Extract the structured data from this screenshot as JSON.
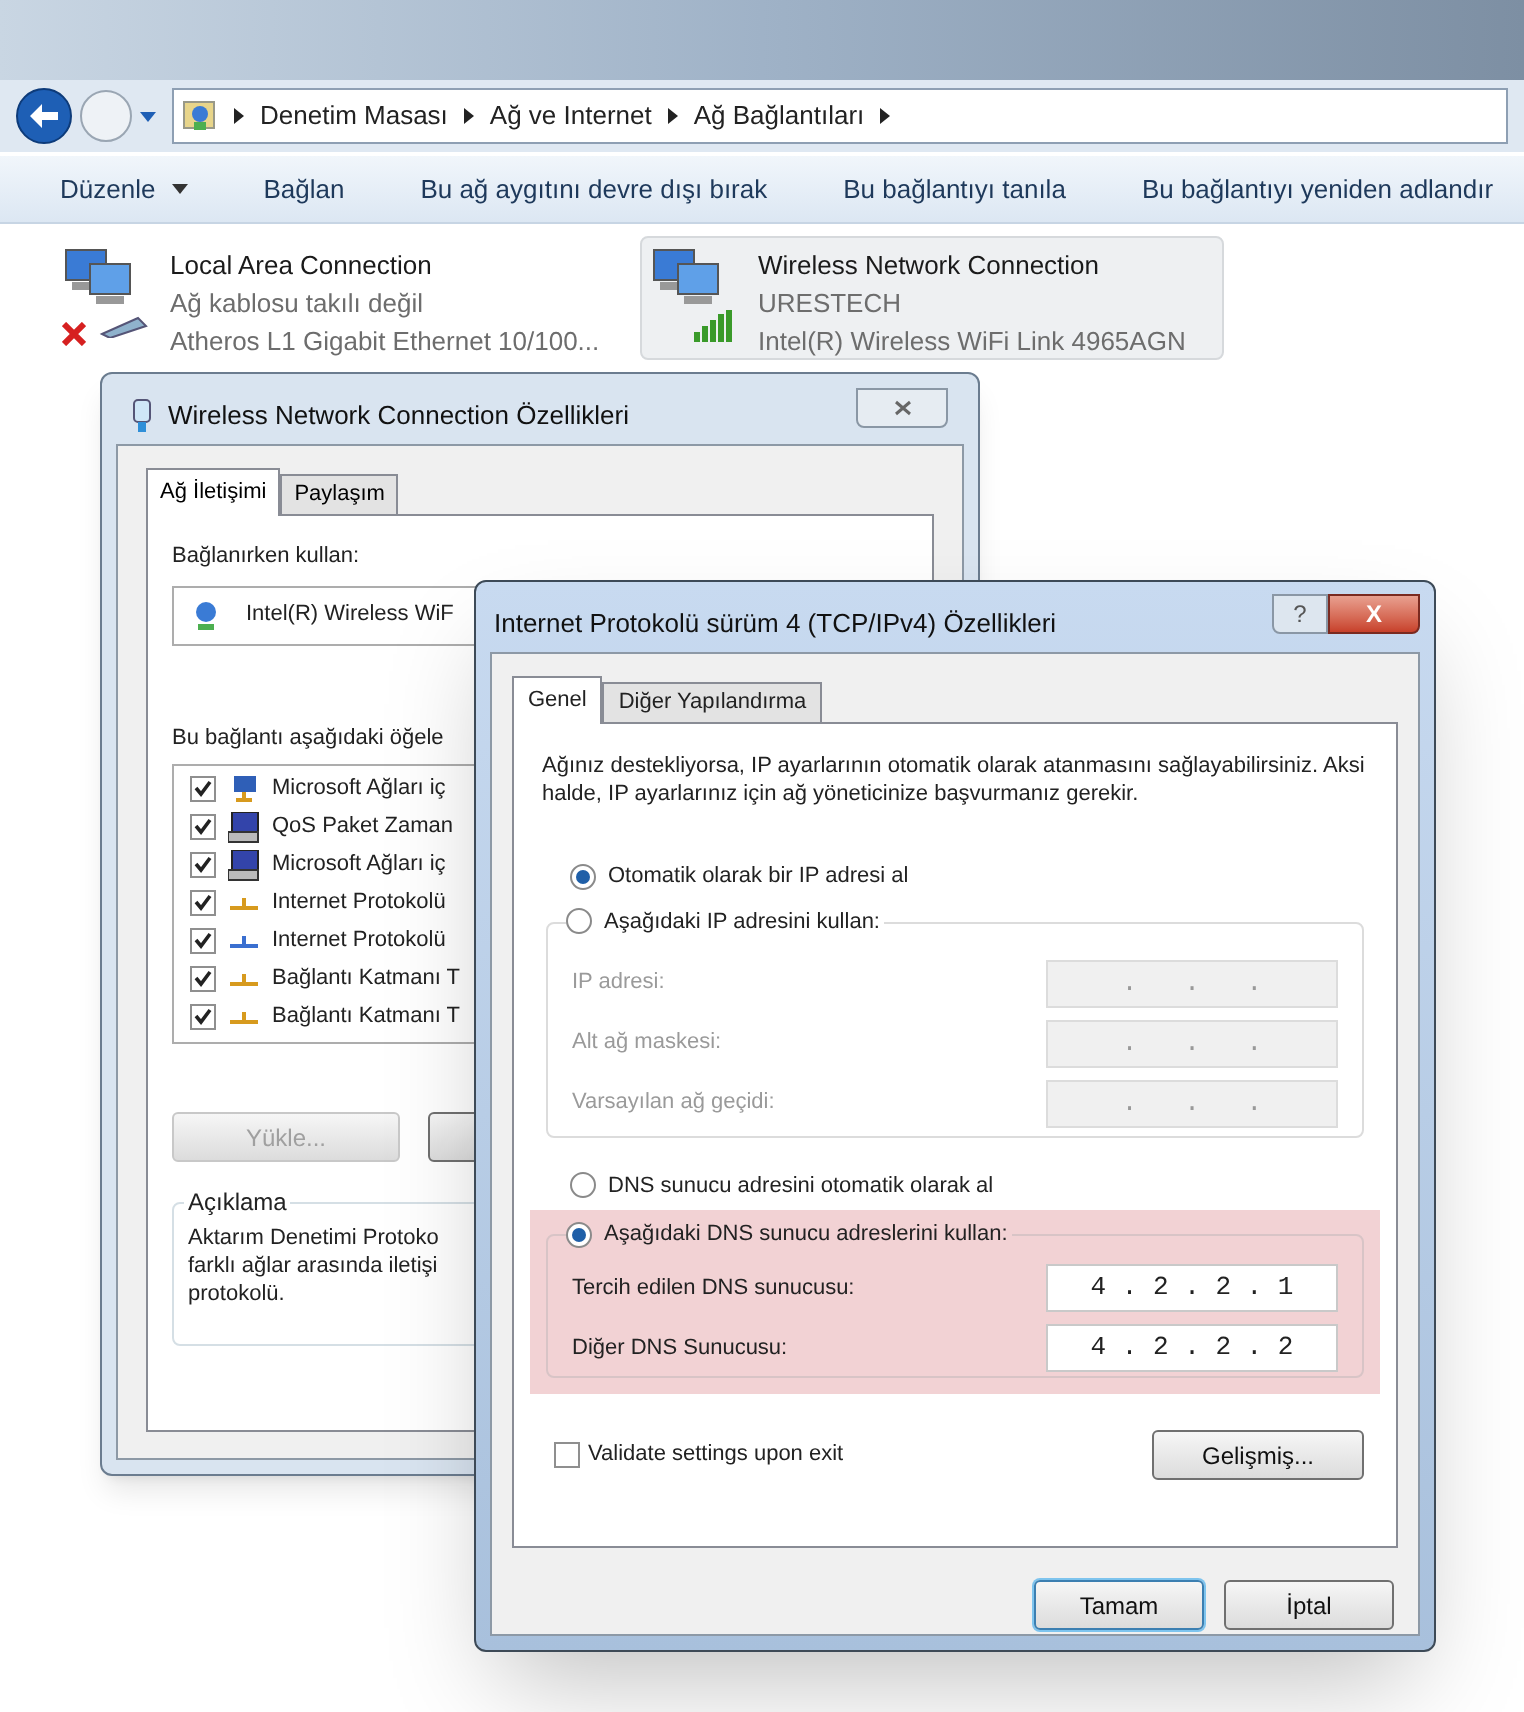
{
  "address_bar": {
    "path": [
      "Denetim Masası",
      "Ağ ve Internet",
      "Ağ Bağlantıları"
    ]
  },
  "toolbar": [
    {
      "label": "Düzenle",
      "kind": "menu"
    },
    {
      "label": "Bağlan",
      "kind": "command"
    },
    {
      "label": "Bu ağ aygıtını devre dışı bırak",
      "kind": "command"
    },
    {
      "label": "Bu bağlantıyı tanıla",
      "kind": "command"
    },
    {
      "label": "Bu bağlantıyı yeniden adlandır",
      "kind": "command"
    }
  ],
  "connections": [
    {
      "name": "Local Area Connection",
      "status": "Ağ kablosu takılı değil",
      "adapter": "Atheros L1 Gigabit Ethernet 10/100...",
      "kind": "wired",
      "connected": false,
      "selected": false
    },
    {
      "name": "Wireless Network Connection",
      "status": "URESTECH",
      "adapter": "Intel(R) Wireless WiFi Link 4965AGN",
      "kind": "wireless",
      "connected": true,
      "selected": true
    }
  ],
  "adapter_dialog": {
    "title": "Wireless Network Connection Özellikleri",
    "tabs": [
      {
        "label": "Ağ İletişimi",
        "selected": true
      },
      {
        "label": "Paylaşım",
        "selected": false
      }
    ],
    "connect_using_label": "Bağlanırken kullan:",
    "adapter": "Intel(R) Wireless WiF",
    "items_label": "Bu bağlantı aşağıdaki öğele",
    "items": [
      {
        "label": "Microsoft Ağları iç",
        "checked": true,
        "kind": "client"
      },
      {
        "label": "QoS Paket Zaman",
        "checked": true,
        "kind": "service"
      },
      {
        "label": "Microsoft Ağları iç",
        "checked": true,
        "kind": "service"
      },
      {
        "label": "Internet Protokolü",
        "checked": true,
        "kind": "protocol"
      },
      {
        "label": "Internet Protokolü",
        "checked": true,
        "kind": "protocol-blue"
      },
      {
        "label": "Bağlantı Katmanı T",
        "checked": true,
        "kind": "protocol"
      },
      {
        "label": "Bağlantı Katmanı T",
        "checked": true,
        "kind": "protocol"
      }
    ],
    "install_button": {
      "label": "Yükle...",
      "disabled": true
    },
    "description_label": "Açıklama",
    "description": [
      "Aktarım Denetimi Protoko",
      "farklı ağlar arasında iletişi",
      "protokolü."
    ]
  },
  "ipv4_dialog": {
    "title": "Internet Protokolü sürüm 4 (TCP/IPv4) Özellikleri",
    "help": "?",
    "close": "X",
    "tabs": [
      {
        "label": "Genel",
        "selected": true
      },
      {
        "label": "Diğer Yapılandırma",
        "selected": false
      }
    ],
    "intro": "Ağınız destekliyorsa, IP ayarlarının otomatik olarak atanmasını sağlayabilirsiniz. Aksi halde, IP ayarlarınız için ağ yöneticinize başvurmanız gerekir.",
    "ip_options": [
      {
        "label": "Otomatik olarak bir IP adresi al",
        "selected": true
      },
      {
        "label": "Aşağıdaki IP adresini kullan:",
        "selected": false
      }
    ],
    "ip_fields": [
      {
        "label": "IP adresi:",
        "value": ".   .   .",
        "disabled": true
      },
      {
        "label": "Alt ağ maskesi:",
        "value": ".   .   .",
        "disabled": true
      },
      {
        "label": "Varsayılan ağ geçidi:",
        "value": ".   .   .",
        "disabled": true
      }
    ],
    "dns_options": [
      {
        "label": "DNS sunucu adresini otomatik olarak al",
        "selected": false
      },
      {
        "label": "Aşağıdaki DNS sunucu adreslerini kullan:",
        "selected": true
      }
    ],
    "dns_highlighted": true,
    "dns_fields": [
      {
        "label": "Tercih edilen DNS sunucusu:",
        "value": "4 . 2 . 2 . 1",
        "disabled": false
      },
      {
        "label": "Diğer DNS Sunucusu:",
        "value": "4 . 2 . 2 . 2",
        "disabled": false
      }
    ],
    "validate": {
      "label": "Validate settings upon exit",
      "checked": false
    },
    "advanced_button": "Gelişmiş...",
    "buttons": [
      {
        "label": "Tamam",
        "default": true
      },
      {
        "label": "İptal",
        "default": false
      }
    ]
  }
}
